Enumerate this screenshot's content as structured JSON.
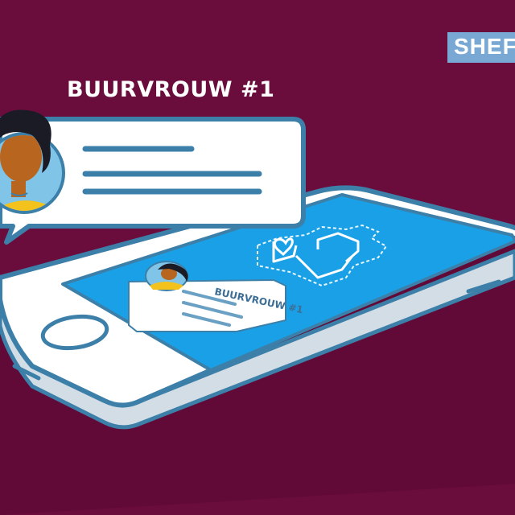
{
  "logo": {
    "text": "SHEF"
  },
  "bubble": {
    "title": "BUURVROUW #1"
  },
  "phone": {
    "notification_title": "BUURVROUW #1"
  },
  "colors": {
    "background": "#6b0d3c",
    "screen": "#1aa0e6",
    "outline": "#3c7fa8",
    "skin": "#b8651f",
    "hair": "#1b1b26",
    "shirt": "#f4c21c",
    "avatar_bg": "#80c4e8"
  }
}
